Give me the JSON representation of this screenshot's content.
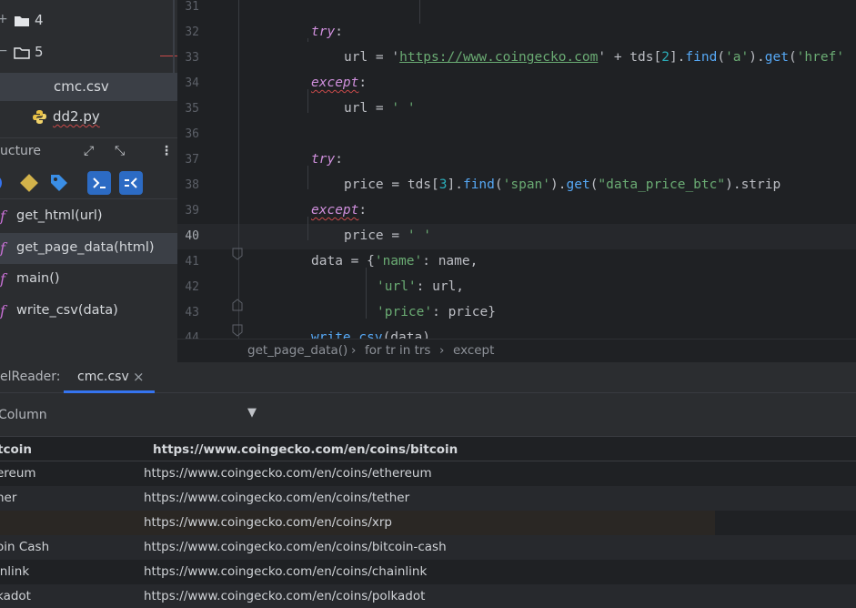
{
  "project_tree": {
    "folder4": {
      "expand": "+",
      "label": "4"
    },
    "folder5": {
      "expand": "−",
      "label": "5"
    },
    "file_csv": "cmc.csv",
    "file_py": "dd2.py"
  },
  "structure": {
    "title": "ucture",
    "items": [
      {
        "icon": "f",
        "label": "get_html(url)"
      },
      {
        "icon": "f",
        "label": "get_page_data(html)"
      },
      {
        "icon": "f",
        "label": "main()"
      },
      {
        "icon": "f",
        "label": "write_csv(data)"
      }
    ]
  },
  "editor": {
    "line_numbers": [
      "31",
      "32",
      "33",
      "34",
      "35",
      "36",
      "37",
      "38",
      "39",
      "40",
      "41",
      "42",
      "43",
      "44"
    ],
    "current_line": "40",
    "lines": [
      [],
      [
        {
          "t": "try",
          "k": "kw"
        },
        {
          "t": ":",
          "k": "pl"
        }
      ],
      [
        {
          "t": "url = '",
          "k": "pl"
        },
        {
          "t": "https://www.coingecko.com",
          "k": "strurl"
        },
        {
          "t": "' + tds[",
          "k": "pl"
        },
        {
          "t": "2",
          "k": "num"
        },
        {
          "t": "].",
          "k": "pl"
        },
        {
          "t": "find",
          "k": "fn"
        },
        {
          "t": "(",
          "k": "pl"
        },
        {
          "t": "'a'",
          "k": "str"
        },
        {
          "t": ").",
          "k": "pl"
        },
        {
          "t": "get",
          "k": "fn"
        },
        {
          "t": "(",
          "k": "pl"
        },
        {
          "t": "'href'",
          "k": "str"
        }
      ],
      [
        {
          "t": "except",
          "k": "kw wavy"
        },
        {
          "t": ":",
          "k": "pl"
        }
      ],
      [
        {
          "t": "url = ",
          "k": "pl"
        },
        {
          "t": "' '",
          "k": "str"
        }
      ],
      [],
      [
        {
          "t": "try",
          "k": "kw"
        },
        {
          "t": ":",
          "k": "pl"
        }
      ],
      [
        {
          "t": "price = tds[",
          "k": "pl"
        },
        {
          "t": "3",
          "k": "num"
        },
        {
          "t": "].",
          "k": "pl"
        },
        {
          "t": "find",
          "k": "fn"
        },
        {
          "t": "(",
          "k": "pl"
        },
        {
          "t": "'span'",
          "k": "str"
        },
        {
          "t": ").",
          "k": "pl"
        },
        {
          "t": "get",
          "k": "fn"
        },
        {
          "t": "(",
          "k": "pl"
        },
        {
          "t": "\"data_price_btc\"",
          "k": "str"
        },
        {
          "t": ").strip",
          "k": "pl"
        }
      ],
      [
        {
          "t": "except",
          "k": "kw wavy"
        },
        {
          "t": ":",
          "k": "pl"
        }
      ],
      [
        {
          "t": "price = ",
          "k": "pl"
        },
        {
          "t": "' '",
          "k": "str"
        }
      ],
      [
        {
          "t": "data = {",
          "k": "pl"
        },
        {
          "t": "'name'",
          "k": "str"
        },
        {
          "t": ": name,",
          "k": "pl"
        }
      ],
      [
        {
          "t": "'url'",
          "k": "str"
        },
        {
          "t": ": url,",
          "k": "pl"
        }
      ],
      [
        {
          "t": "'price'",
          "k": "str"
        },
        {
          "t": ": price}",
          "k": "pl"
        }
      ],
      [
        {
          "t": "write_csv",
          "k": "fn"
        },
        {
          "t": "(data)",
          "k": "pl"
        }
      ]
    ]
  },
  "breadcrumb": {
    "items": [
      "get_page_data()",
      "for tr in trs",
      "except"
    ],
    "separator": "›"
  },
  "bottom_panel": {
    "tool_title": "elReader:",
    "tab_label": "cmc.csv",
    "tab_close": "×",
    "column_selector": "Column",
    "dropdown_arrow": "▼",
    "header": {
      "name": "tcoin",
      "url": "https://www.coingecko.com/en/coins/bitcoin"
    },
    "rows": [
      {
        "name": "ereum",
        "url": "https://www.coingecko.com/en/coins/ethereum"
      },
      {
        "name": "her",
        "url": "https://www.coingecko.com/en/coins/tether"
      },
      {
        "name": "",
        "url": "https://www.coingecko.com/en/coins/xrp"
      },
      {
        "name": "oin Cash",
        "url": "https://www.coingecko.com/en/coins/bitcoin-cash"
      },
      {
        "name": "inlink",
        "url": "https://www.coingecko.com/en/coins/chainlink"
      },
      {
        "name": "kadot",
        "url": "https://www.coingecko.com/en/coins/polkadot"
      }
    ]
  },
  "colors": {
    "accent": "#3574f0",
    "keyword": "#cf8fdc",
    "string": "#6aab73",
    "function": "#56a8f5",
    "number": "#2aacb8"
  }
}
